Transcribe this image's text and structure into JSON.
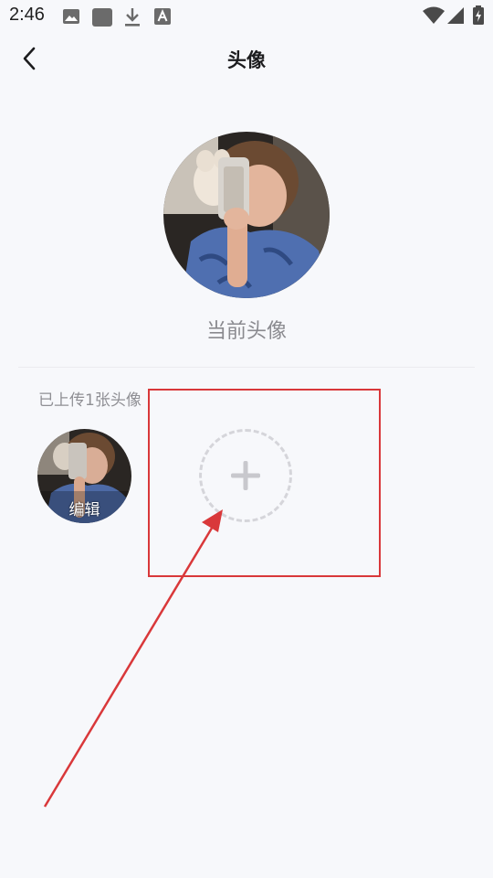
{
  "status_bar": {
    "time": "2:46",
    "left_icons": [
      "image-icon",
      "square-app-icon",
      "download-icon",
      "font-a-icon"
    ],
    "right_icons": [
      "wifi-icon",
      "signal-icon",
      "battery-charging-icon"
    ]
  },
  "header": {
    "title": "头像",
    "back_icon": "chevron-left-icon"
  },
  "current_avatar": {
    "label": "当前头像"
  },
  "uploaded": {
    "count_text": "已上传1张头像",
    "items": [
      {
        "edit_label": "编辑"
      }
    ],
    "add_icon": "plus-icon"
  },
  "annotation": {
    "color": "#d9383a"
  }
}
